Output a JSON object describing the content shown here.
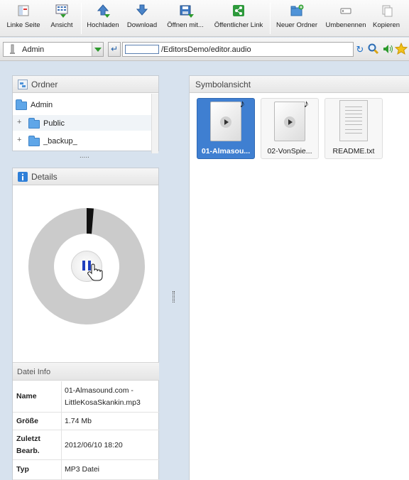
{
  "toolbar": {
    "buttons": [
      {
        "label": "Linke Seite",
        "icon": "left-pane-icon"
      },
      {
        "label": "Ansicht",
        "icon": "view-grid-icon"
      },
      {
        "label": "Hochladen",
        "icon": "upload-arrow-icon"
      },
      {
        "label": "Download",
        "icon": "download-arrow-icon"
      },
      {
        "label": "Öffnen mit...",
        "icon": "open-with-icon"
      },
      {
        "label": "Öffentlicher Link",
        "icon": "share-icon"
      },
      {
        "label": "Neuer Ordner",
        "icon": "new-folder-icon"
      },
      {
        "label": "Umbenennen",
        "icon": "rename-icon"
      },
      {
        "label": "Kopieren",
        "icon": "copy-icon"
      }
    ]
  },
  "addressbar": {
    "user": "Admin",
    "path": "/EditorsDemo/editor.audio"
  },
  "folders": {
    "title": "Ordner",
    "items": [
      {
        "label": "Admin"
      },
      {
        "label": "Public"
      },
      {
        "label": "_backup_"
      }
    ],
    "resize_handle": "....."
  },
  "details": {
    "title": "Details",
    "player": {
      "progress_percent": 2
    }
  },
  "file_info": {
    "title": "Datei Info",
    "rows": [
      {
        "key": "Name",
        "value": "01-Almasound.com - LittleKosaSkankin.mp3"
      },
      {
        "key": "Größe",
        "value": "1.74 Mb"
      },
      {
        "key": "Zuletzt Bearb.",
        "value": "2012/06/10 18:20"
      },
      {
        "key": "Typ",
        "value": "MP3 Datei"
      }
    ]
  },
  "main": {
    "title": "Symbolansicht",
    "files": [
      {
        "name": "01-Almasou...",
        "selected": true,
        "kind": "audio"
      },
      {
        "name": "02-VonSpie...",
        "selected": false,
        "kind": "audio"
      },
      {
        "name": "README.txt",
        "selected": false,
        "kind": "text"
      }
    ]
  },
  "colors": {
    "selection": "#3f7fd1",
    "folder": "#5fa6e8",
    "accent_green": "#2d9a2d",
    "pause_blue": "#1f3fbf"
  }
}
